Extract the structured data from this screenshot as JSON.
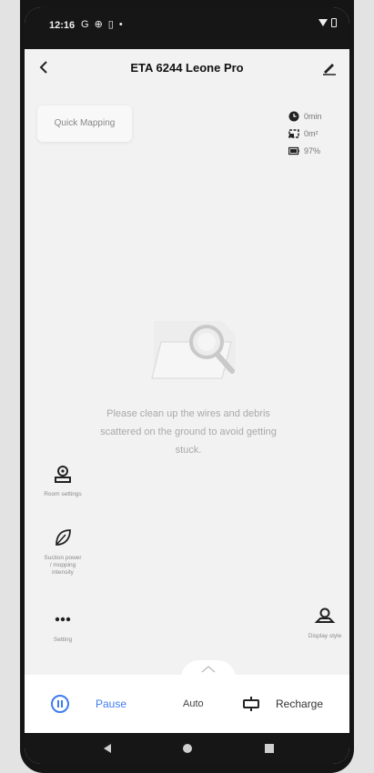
{
  "status_bar": {
    "time": "12:16",
    "icons": [
      "google-icon",
      "settings-icon",
      "sim-icon",
      "dot-icon",
      "wifi-icon",
      "battery-icon"
    ]
  },
  "header": {
    "title": "ETA 6244 Leone Pro"
  },
  "quick_mapping": {
    "label": "Quick Mapping"
  },
  "stats": [
    {
      "icon": "clock-icon",
      "value": "0min"
    },
    {
      "icon": "area-icon",
      "value": "0m²"
    },
    {
      "icon": "battery-icon",
      "value": "97%"
    }
  ],
  "message": "Please clean up the wires and debris scattered on the ground to avoid getting stuck.",
  "left_tools": [
    {
      "icon": "room-settings-icon",
      "label": "Room settings"
    },
    {
      "icon": "suction-leaf-icon",
      "label": "Suction power / mopping intensity"
    },
    {
      "icon": "more-icon",
      "label": "Setting"
    }
  ],
  "right_tool": {
    "icon": "display-style-icon",
    "label": "Display style"
  },
  "actions": {
    "pause": "Pause",
    "auto": "Auto",
    "recharge": "Recharge"
  },
  "colors": {
    "accent": "#3e7cf0",
    "background": "#f2f2f2",
    "text_muted": "#a9a9a9"
  }
}
